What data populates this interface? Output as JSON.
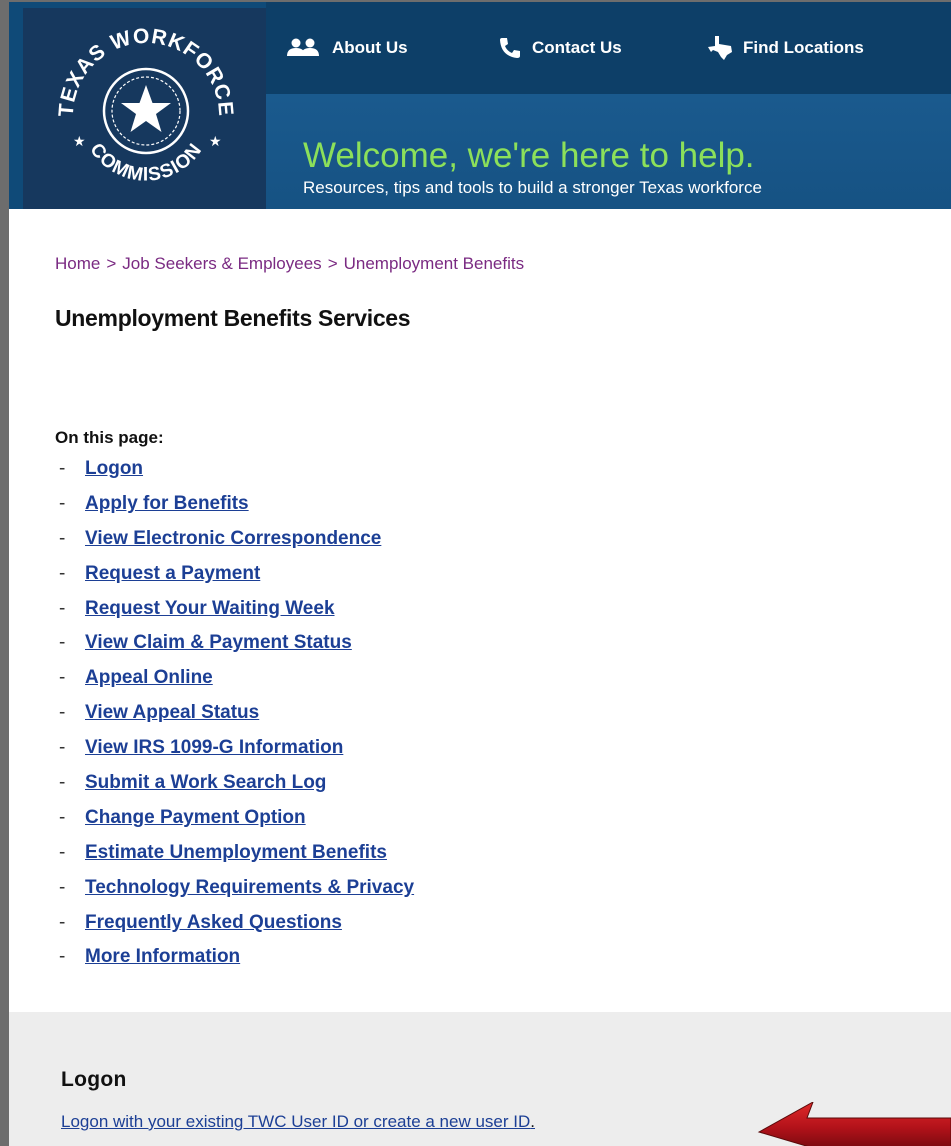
{
  "logo": {
    "text_top": "TEXAS WORKFORCE",
    "text_bottom": "COMMISSION"
  },
  "nav": {
    "about": "About Us",
    "contact": "Contact Us",
    "find": "Find Locations"
  },
  "banner": {
    "welcome": "Welcome, we're here to help.",
    "tagline": "Resources, tips and tools to build a stronger Texas workforce"
  },
  "breadcrumb": [
    "Home",
    "Job Seekers & Employees",
    "Unemployment Benefits"
  ],
  "breadcrumb_sep": ">",
  "page_title": "Unemployment Benefits Services",
  "on_this_page": "On this page:",
  "toc_dash": "-",
  "toc": [
    "Logon",
    "Apply for Benefits",
    "View Electronic Correspondence",
    "Request a Payment",
    "Request Your Waiting Week",
    "View Claim & Payment Status",
    "Appeal Online",
    "View Appeal Status",
    "View IRS 1099-G Information",
    "Submit a Work Search Log",
    "Change Payment Option",
    "Estimate Unemployment Benefits",
    "Technology Requirements & Privacy",
    "Frequently Asked Questions",
    "More Information"
  ],
  "logon_section": {
    "title": "Logon",
    "link": "Logon with your existing TWC User ID or create a new user ID",
    "period": "."
  },
  "colors": {
    "header": "#0f4a78",
    "logo_bg": "#16385e",
    "welcome_green": "#8ce05a",
    "link_blue": "#1c3f95",
    "breadcrumb_purple": "#7a2a82",
    "arrow_red": "#c0141a"
  }
}
